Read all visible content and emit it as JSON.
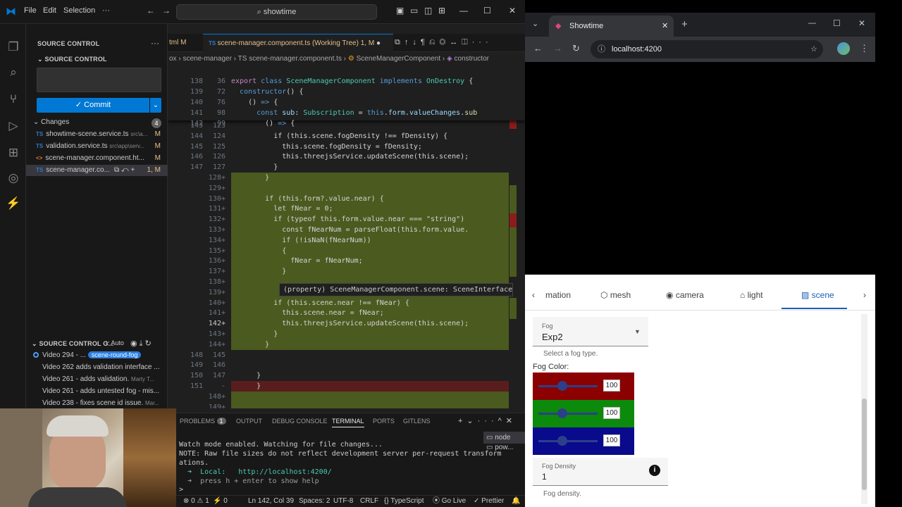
{
  "vscode": {
    "menu": [
      "File",
      "Edit",
      "Selection",
      "···"
    ],
    "search": "showtime",
    "sidebar": {
      "title": "SOURCE CONTROL",
      "section": "SOURCE CONTROL",
      "commit_label": "✓ Commit",
      "changes_label": "Changes",
      "changes_count": "4",
      "changes": [
        {
          "name": "showtime-scene.service.ts",
          "path": "src\\a...",
          "status": "M"
        },
        {
          "name": "validation.service.ts",
          "path": "src\\app\\serv...",
          "status": "M"
        },
        {
          "name": "scene-manager.component.ht...",
          "path": "",
          "status": "M"
        },
        {
          "name": "scene-manager.co...",
          "path": "",
          "status": "1, M"
        }
      ],
      "graph_title": "SOURCE CONTROL G...",
      "graph_auto": "Auto",
      "graph": [
        {
          "msg": "Video 294 - ...",
          "tag": "scene-round-fog",
          "author": ""
        },
        {
          "msg": "Video 262 adds validation interface ...",
          "tag": "",
          "author": ""
        },
        {
          "msg": "Video 261 - adds validation.",
          "tag": "",
          "author": "Marty T..."
        },
        {
          "msg": "Video 261 - adds untested fog - mis...",
          "tag": "",
          "author": ""
        },
        {
          "msg": "Video 238 - fixes scene id issue.",
          "tag": "",
          "author": "Mar..."
        }
      ]
    },
    "tabs": {
      "prev": "tml M",
      "active": "scene-manager.component.ts (Working Tree)",
      "active_status": "1, M"
    },
    "breadcrumb": [
      "ox",
      "scene-manager",
      "TS scene-manager.component.ts",
      "SceneManagerComponent",
      "constructor"
    ],
    "sticky": [
      {
        "l1": "138",
        "l2": "36",
        "code": "export class SceneManagerComponent implements OnDestroy {"
      },
      {
        "l1": "139",
        "l2": "72",
        "code": "  constructor() {"
      },
      {
        "l1": "140",
        "l2": "76",
        "code": "    () => {"
      },
      {
        "l1": "141",
        "l2": "98",
        "code": "      const sub: Subscription = this.form.valueChanges.sub"
      },
      {
        "l1": "142",
        "l2": "99",
        "code": "        () => {"
      }
    ],
    "lines": [
      {
        "l1": "143",
        "l2": "123",
        "code": "",
        "diff": ""
      },
      {
        "l1": "144",
        "l2": "124",
        "code": "          if (this.scene.fogDensity !== fDensity) {",
        "diff": ""
      },
      {
        "l1": "145",
        "l2": "125",
        "code": "            this.scene.fogDensity = fDensity;",
        "diff": ""
      },
      {
        "l1": "146",
        "l2": "126",
        "code": "            this.threejsService.updateScene(this.scene);",
        "diff": ""
      },
      {
        "l1": "147",
        "l2": "127",
        "code": "          }",
        "diff": ""
      },
      {
        "l1": "",
        "l2": "128+",
        "code": "        }",
        "diff": "add"
      },
      {
        "l1": "",
        "l2": "129+",
        "code": "",
        "diff": "add"
      },
      {
        "l1": "",
        "l2": "130+",
        "code": "        if (this.form?.value.near) {",
        "diff": "add"
      },
      {
        "l1": "",
        "l2": "131+",
        "code": "          let fNear = 0;",
        "diff": "add"
      },
      {
        "l1": "",
        "l2": "132+",
        "code": "          if (typeof this.form.value.near === \"string\")",
        "diff": "add"
      },
      {
        "l1": "",
        "l2": "133+",
        "code": "            const fNearNum = parseFloat(this.form.value.",
        "diff": "add"
      },
      {
        "l1": "",
        "l2": "134+",
        "code": "            if (!isNaN(fNearNum))",
        "diff": "add"
      },
      {
        "l1": "",
        "l2": "135+",
        "code": "            {",
        "diff": "add"
      },
      {
        "l1": "",
        "l2": "136+",
        "code": "              fNear = fNearNum;",
        "diff": "add"
      },
      {
        "l1": "",
        "l2": "137+",
        "code": "            }",
        "diff": "add"
      },
      {
        "l1": "",
        "l2": "138+",
        "code": "",
        "diff": "add"
      },
      {
        "l1": "",
        "l2": "139+",
        "code": "",
        "diff": "add"
      },
      {
        "l1": "",
        "l2": "140+",
        "code": "          if (this.scene.near !== fNear) {",
        "diff": "add"
      },
      {
        "l1": "",
        "l2": "141+",
        "code": "            this.scene.near = fNear;",
        "diff": "add"
      },
      {
        "l1": "",
        "l2": "142+",
        "code": "            this.threejsService.updateScene(this.scene);",
        "diff": "add"
      },
      {
        "l1": "",
        "l2": "143+",
        "code": "          }",
        "diff": "add"
      },
      {
        "l1": "",
        "l2": "144+",
        "code": "        }",
        "diff": "add"
      },
      {
        "l1": "148",
        "l2": "145",
        "code": "",
        "diff": ""
      },
      {
        "l1": "149",
        "l2": "146",
        "code": "",
        "diff": ""
      },
      {
        "l1": "150",
        "l2": "147",
        "code": "      }",
        "diff": ""
      },
      {
        "l1": "151",
        "l2": "-",
        "code": "      }",
        "diff": "del"
      },
      {
        "l1": "",
        "l2": "148+",
        "code": "",
        "diff": "add"
      },
      {
        "l1": "",
        "l2": "149+",
        "code": "",
        "diff": "add"
      }
    ],
    "hover": "(property) SceneManagerComponent.scene: SceneInterface",
    "panel": {
      "tabs": [
        "PROBLEMS",
        "OUTPUT",
        "DEBUG CONSOLE",
        "TERMINAL",
        "PORTS",
        "GITLENS"
      ],
      "problems_count": "1",
      "terminals": [
        "node",
        "pow..."
      ],
      "lines": [
        "Watch mode enabled. Watching for file changes...",
        "NOTE: Raw file sizes do not reflect development server per-request transform",
        "ations.",
        "  ➜  Local:   http://localhost:4200/",
        "  ➜  press h + enter to show help",
        ">"
      ]
    },
    "status": {
      "errors": "⊗ 0 ⚠ 1",
      "ports": "⚡ 0",
      "position": "Ln 142, Col 39",
      "spaces": "Spaces: 2",
      "encoding": "UTF-8",
      "eol": "CRLF",
      "language": "{} TypeScript",
      "golive": "Go Live",
      "prettier": "✓ Prettier"
    }
  },
  "browser": {
    "tab_title": "Showtime",
    "url": "localhost:4200",
    "app": {
      "tabs": [
        "mation",
        "mesh",
        "camera",
        "light",
        "scene"
      ],
      "active_tab": "scene",
      "fog_label": "Fog",
      "fog_value": "Exp2",
      "fog_hint": "Select a fog type.",
      "fog_color_label": "Fog Color:",
      "rgb": [
        {
          "channel": "red",
          "value": "100",
          "color": "#8b0000"
        },
        {
          "channel": "green",
          "value": "100",
          "color": "#0b8a0b"
        },
        {
          "channel": "blue",
          "value": "100",
          "color": "#0a0a8c"
        }
      ],
      "density_label": "Fog Density",
      "density_value": "1",
      "density_hint": "Fog density."
    }
  }
}
